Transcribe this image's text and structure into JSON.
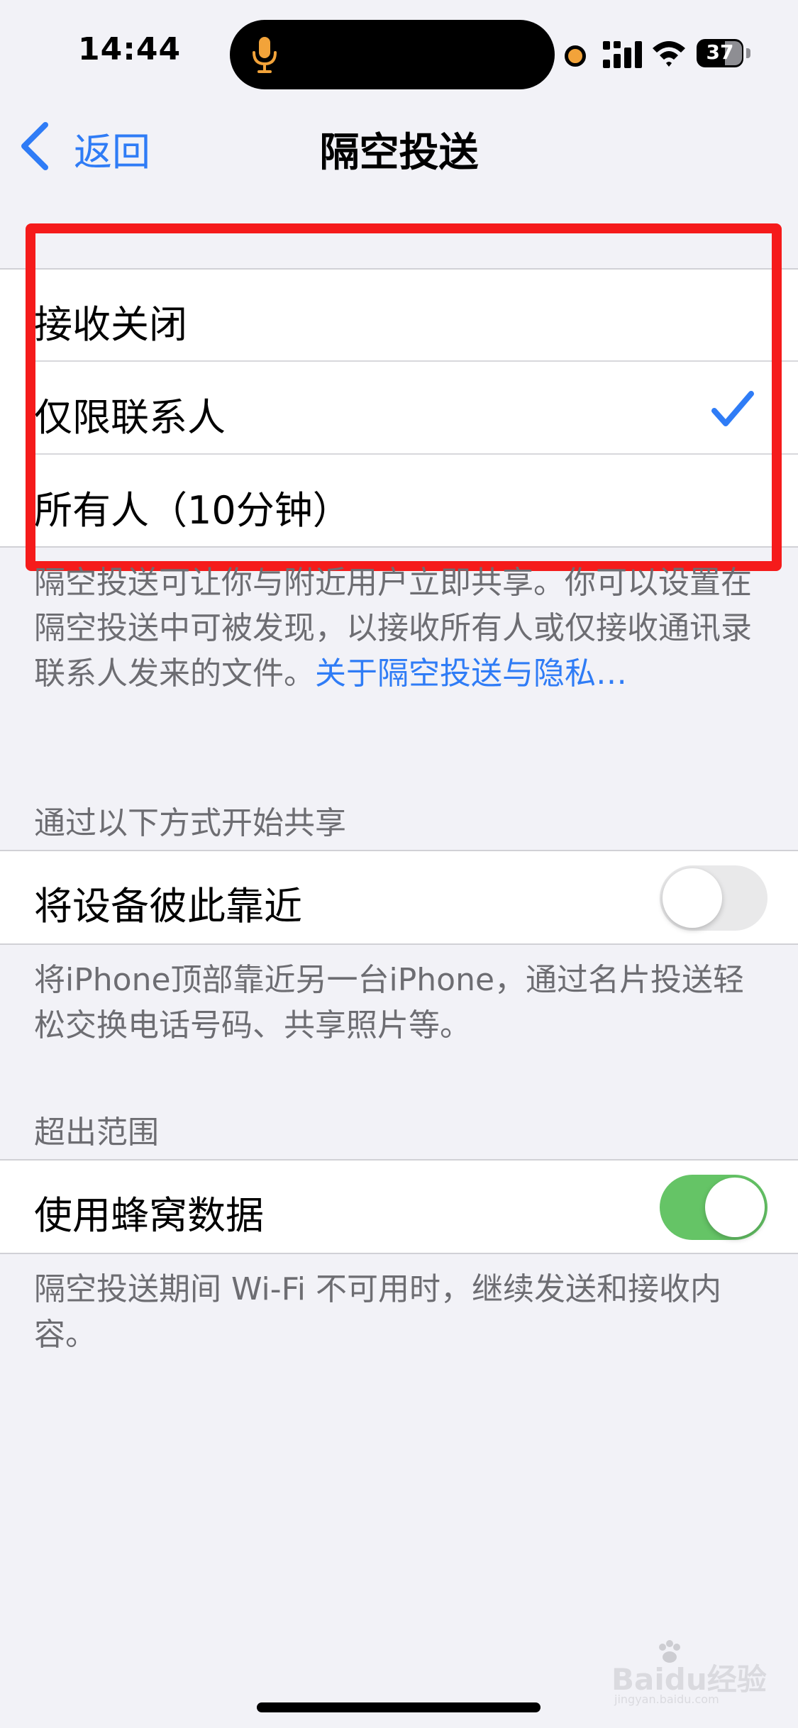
{
  "status_bar": {
    "time": "14:44",
    "battery": "37"
  },
  "nav": {
    "back_label": "返回",
    "title": "隔空投送"
  },
  "receive_options": [
    {
      "label": "接收关闭",
      "selected": false
    },
    {
      "label": "仅限联系人",
      "selected": true
    },
    {
      "label": "所有人（10分钟）",
      "selected": false
    }
  ],
  "receive_footer": {
    "text": "隔空投送可让你与附近用户立即共享。你可以设置在隔空投送中可被发现，以接收所有人或仅接收通讯录联系人发来的文件。",
    "link": "关于隔空投送与隐私…"
  },
  "share_section": {
    "header": "通过以下方式开始共享",
    "row_label": "将设备彼此靠近",
    "toggle_on": false,
    "footer": "将iPhone顶部靠近另一台iPhone，通过名片投送轻松交换电话号码、共享照片等。"
  },
  "range_section": {
    "header": "超出范围",
    "row_label": "使用蜂窝数据",
    "toggle_on": true,
    "footer": "隔空投送期间 Wi-Fi 不可用时，继续发送和接收内容。"
  },
  "watermark": {
    "text": "Baidu经验",
    "sub_text": "jingyan.baidu.com"
  },
  "colors": {
    "accent": "#2F7CF6",
    "toggle_on": "#65C466",
    "highlight": "#F51B1B",
    "background": "#F2F2F7"
  }
}
